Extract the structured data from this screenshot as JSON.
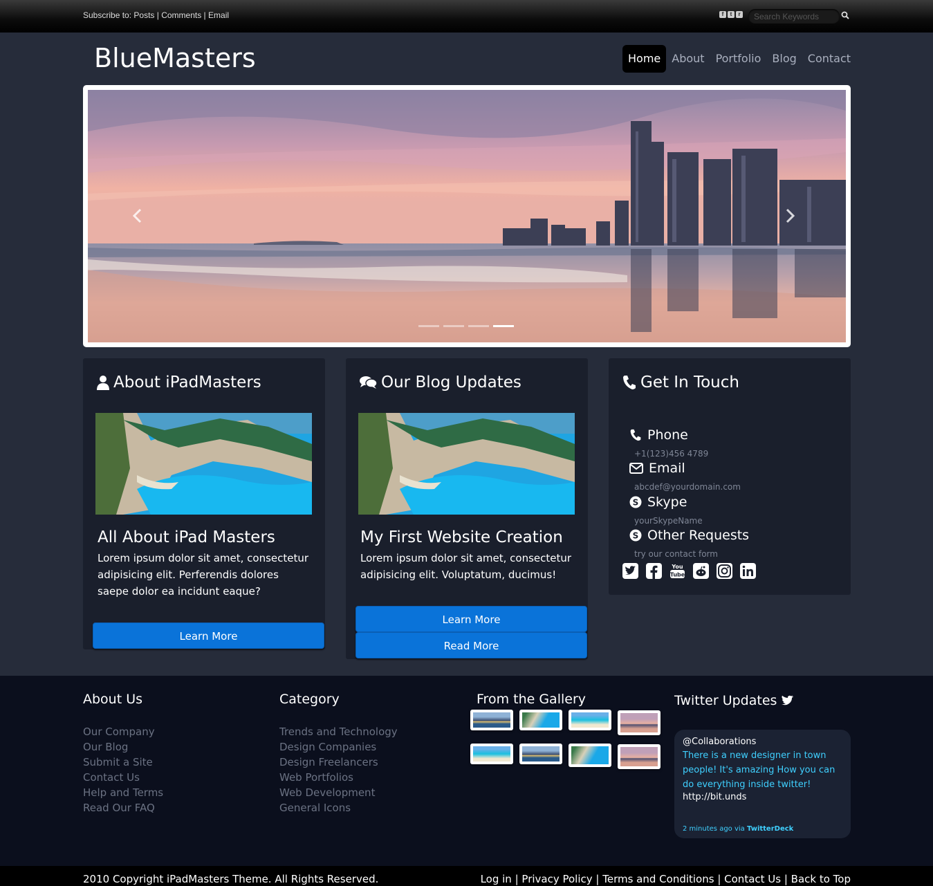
{
  "topbar": {
    "subscribe_prefix": "Subscribe to:",
    "links": [
      "Posts",
      "Comments",
      "Email"
    ],
    "search_placeholder": "Search Keywords"
  },
  "header": {
    "brand": "BlueMasters",
    "nav": [
      "Home",
      "About",
      "Portfolio",
      "Blog",
      "Contact"
    ],
    "active": "Home"
  },
  "slider": {
    "slide_count": 4,
    "active_slide": 4
  },
  "about": {
    "title": "About iPadMasters",
    "card_title": "All About iPad Masters",
    "text": "Lorem ipsum dolor sit amet, consectetur adipisicing elit. Perferendis dolores saepe dolor ea incidunt eaque?",
    "button": "Learn More"
  },
  "blog": {
    "title": "Our Blog Updates",
    "card_title": "My First Website Creation",
    "text": "Lorem ipsum dolor sit amet, consectetur adipisicing elit. Voluptatum, ducimus!",
    "button1": "Learn More",
    "button2": "Read More"
  },
  "contact": {
    "title": "Get In Touch",
    "items": [
      {
        "label": "Phone",
        "value": "+1(123)456 4789"
      },
      {
        "label": "Email",
        "value": "abcdef@yourdomain.com"
      },
      {
        "label": "Skype",
        "value": "yourSkypeName"
      },
      {
        "label": "Other Requests",
        "value": "try our contact form"
      }
    ],
    "youtube_text": "You Tube"
  },
  "footer": {
    "about_title": "About Us",
    "about_links": [
      "Our Company",
      "Our Blog",
      "Submit a Site",
      "Contact Us",
      "Help and Terms",
      "Read Our FAQ"
    ],
    "category_title": "Category",
    "category_links": [
      "Trends and Technology",
      "Design Companies",
      "Design Freelancers",
      "Web Portfolios",
      "Web Development",
      "General Icons"
    ],
    "gallery_title": "From the Gallery",
    "twitter_title": "Twitter Updates",
    "tweet": {
      "user": "@Collaborations",
      "text": "There is a new designer in town people! It's amazing How you can do everything inside twitter!",
      "link": "http://bit.unds",
      "time": "2 minutes ago via",
      "source": "TwitterDeck"
    }
  },
  "bottom": {
    "copyright": "2010 Copyright iPadMasters Theme. All Rights Reserved.",
    "links": [
      "Log in",
      "Privacy Policy",
      "Terms and Conditions",
      "Contact Us",
      "Back to Top"
    ]
  },
  "colors": {
    "background": "#262c3a",
    "panel": "#1a1f2c",
    "accent_button": "#0a73d9",
    "footer": "#0b0f1d",
    "tweet_text": "#3fd0ff"
  }
}
